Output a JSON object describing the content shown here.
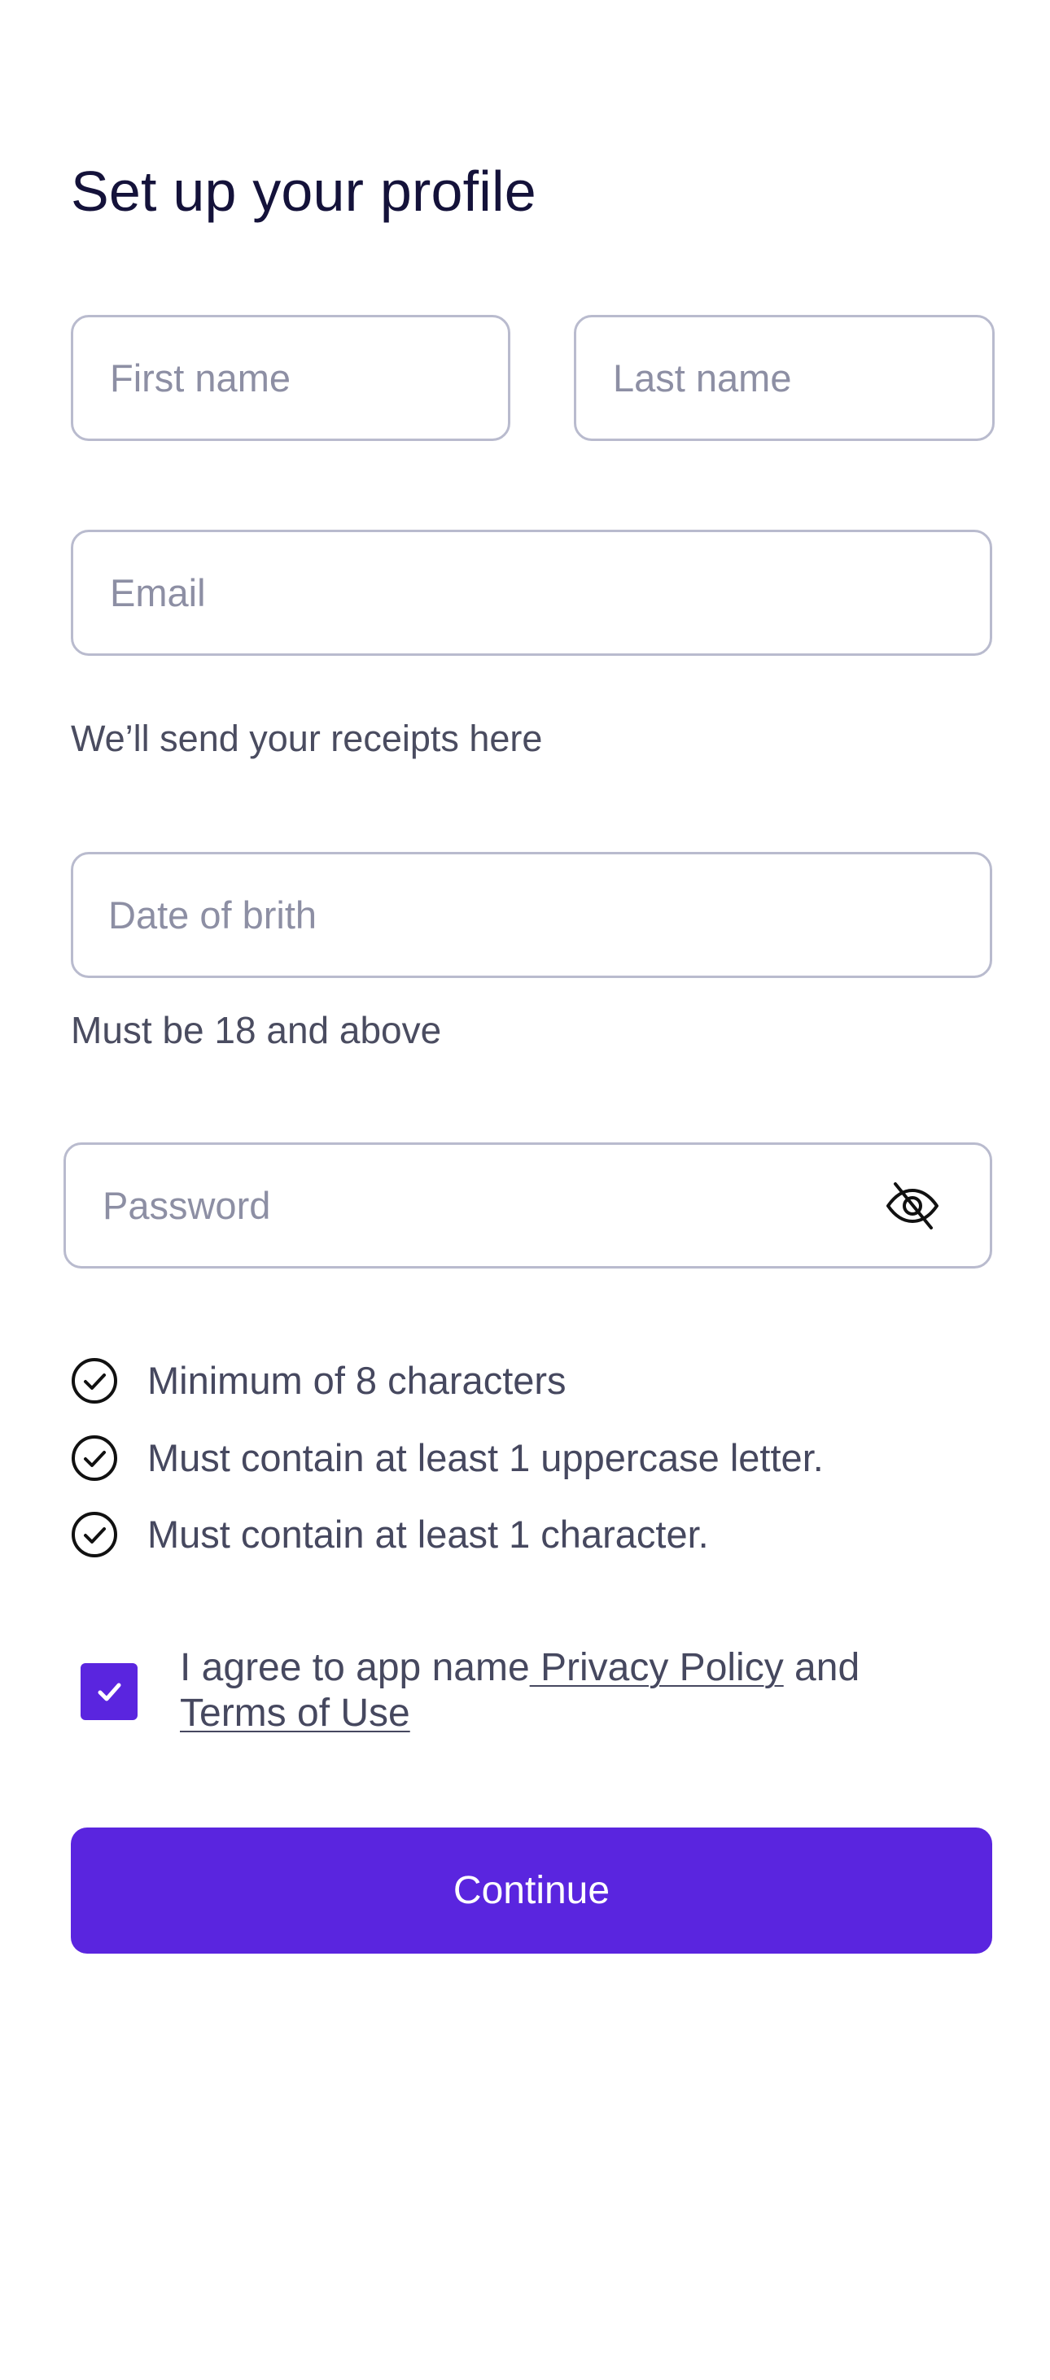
{
  "header": {
    "title": "Set up your profile"
  },
  "form": {
    "first_name": {
      "placeholder": "First name",
      "value": ""
    },
    "last_name": {
      "placeholder": "Last name",
      "value": ""
    },
    "email": {
      "placeholder": "Email",
      "value": "",
      "helper": "We’ll send your receipts here"
    },
    "dob": {
      "placeholder": "Date of brith",
      "value": "",
      "helper": "Must be 18 and above"
    },
    "password": {
      "placeholder": "Password",
      "value": "",
      "visibility_icon": "eye-off-icon"
    },
    "password_rules": [
      {
        "text": "Minimum of 8 characters",
        "icon": "check-circle-icon"
      },
      {
        "text": "Must contain at least 1 uppercase letter.",
        "icon": "check-circle-icon"
      },
      {
        "text": "Must contain at least 1 character.",
        "icon": "check-circle-icon"
      }
    ],
    "consent": {
      "checked": true,
      "text_before": "I agree to app name",
      "privacy_link": " Privacy Policy",
      "text_middle": " and",
      "terms_link": "Terms of Use"
    },
    "continue_label": "Continue"
  },
  "colors": {
    "accent": "#5A25DF",
    "title": "#14123A",
    "text": "#46485F",
    "placeholder": "#8D8FA4",
    "border": "#B9BBCE"
  }
}
